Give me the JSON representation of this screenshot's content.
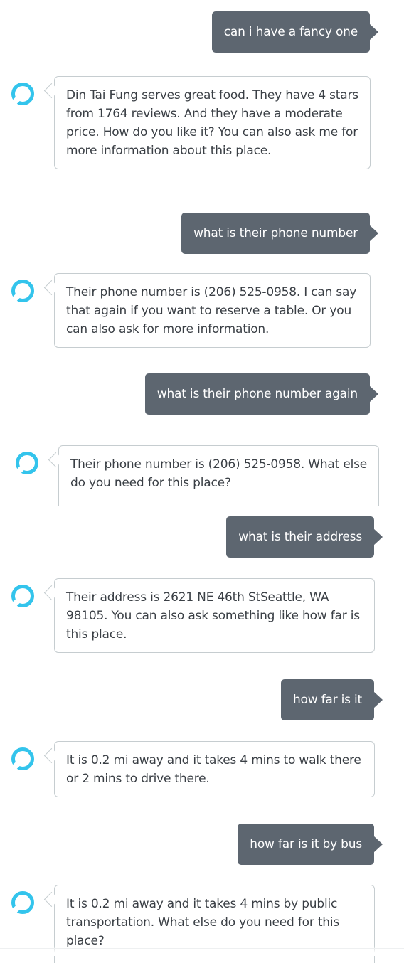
{
  "conversation": {
    "messages": [
      {
        "role": "user",
        "text": "can i have a fancy one"
      },
      {
        "role": "assistant",
        "text": "Din Tai Fung serves great food. They have 4 stars from 1764 reviews. And they have a moderate price. How do you like it? You can also ask me for more information about this place."
      },
      {
        "role": "user",
        "text": "what is their phone number"
      },
      {
        "role": "assistant",
        "text": "Their phone number is (206) 525-0958. I can say that again if you want to reserve a table. Or you can also ask for more information."
      },
      {
        "role": "user",
        "text": "what is their phone number again"
      },
      {
        "role": "assistant",
        "text": "Their phone number is (206) 525-0958. What else do you need for this place?"
      },
      {
        "role": "user",
        "text": "what is their address"
      },
      {
        "role": "assistant",
        "text": "Their address is 2621 NE 46th StSeattle, WA 98105. You can also ask something like how far is this place."
      },
      {
        "role": "user",
        "text": "how far is it"
      },
      {
        "role": "assistant",
        "text": "It is 0.2 mi away and it takes 4 mins to walk there or 2 mins to drive there."
      },
      {
        "role": "user",
        "text": "how far is it by bus"
      },
      {
        "role": "assistant",
        "text": "It is 0.2 mi away and it takes 4 mins by public transportation. What else do you need for this place?"
      }
    ]
  },
  "colors": {
    "user_bubble": "#5d6670",
    "bot_border": "#c6cdd0",
    "assistant_icon": "#33c4ec",
    "bot_text": "#3a3f45"
  },
  "icons": {
    "assistant_avatar": "alexa-ring-icon"
  }
}
